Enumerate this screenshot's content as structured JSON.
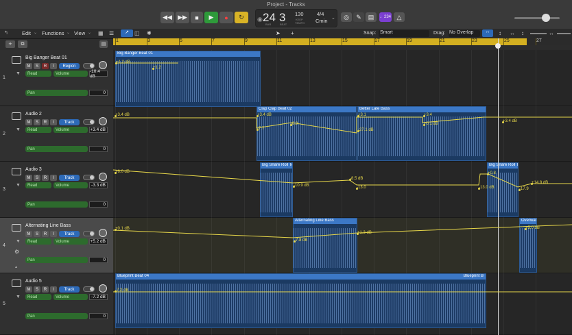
{
  "window": {
    "title": "Project - Tracks"
  },
  "transport": {
    "rewind_icon": "rewind-icon",
    "forward_icon": "forward-icon",
    "stop_icon": "stop-icon",
    "play_icon": "play-icon",
    "record_icon": "record-icon",
    "cycle_icon": "cycle-icon",
    "bar": "24",
    "beat": "3",
    "bar_label": "BAR",
    "beat_label": "BEAT",
    "tempo": "130",
    "tempo_label_1": "KEEP",
    "tempo_label_2": "TEMPO",
    "time_sig": "4/4",
    "key": "Cmin",
    "count_in": "♩234",
    "colors": {
      "play": "#2e9a3a",
      "record": "#d23030",
      "cycle": "#d9b326",
      "purple_btn": "#7b3fd1"
    }
  },
  "menubar": {
    "edit": "Edit",
    "functions": "Functions",
    "view": "View",
    "snap_label": "Snap:",
    "snap_value": "Smart",
    "drag_label": "Drag:",
    "drag_value": "No Overlap"
  },
  "ruler": {
    "bars": [
      "1",
      "3",
      "5",
      "7",
      "9",
      "11",
      "13",
      "15",
      "17",
      "19",
      "21",
      "23",
      "25",
      "27"
    ]
  },
  "tracks": [
    {
      "num": "1",
      "name": "Big Banger Beat 01",
      "automation_mode": "Read",
      "param": "Volume",
      "value": "-10.4 dB",
      "mode_button": "Region",
      "pan_label": "Pan",
      "pan_value": "0",
      "regions": [
        {
          "name": "Big Banger Beat 01"
        }
      ],
      "labels": [
        "+1.2 dB",
        "+1.2"
      ]
    },
    {
      "num": "2",
      "name": "Audio 2",
      "automation_mode": "Read",
      "param": "Volume",
      "value": "+3.4 dB",
      "mode_button": "Track",
      "pan_label": "Pan",
      "pan_value": "0",
      "regions": [
        {
          "name": "Clap Clap Beat 02"
        },
        {
          "name": "Better Late Bass"
        }
      ],
      "labels": [
        "+3.4 dB",
        "+3.4 dB",
        "-8.9",
        "-7.7",
        "+3.1",
        "-27.1 dB",
        "+3.4",
        "+0.1 dB",
        "+3.4 dB"
      ]
    },
    {
      "num": "3",
      "name": "Audio 3",
      "automation_mode": "Read",
      "param": "Volume",
      "value": "-3.3 dB",
      "mode_button": "Track",
      "pan_label": "Pan",
      "pan_value": "0",
      "regions": [
        {
          "name": "Big Snare Roll To"
        },
        {
          "name": "Big Snare Roll To"
        }
      ],
      "labels": [
        "+6.0 dB",
        "-10.9 dB",
        "-8.5 dB",
        "-13.0",
        "+0.8",
        "-13.0 dB",
        "-17.9",
        "+14.8 dB"
      ]
    },
    {
      "num": "4",
      "name": "Alternating Line Bass",
      "automation_mode": "Read",
      "param": "Volume",
      "value": "+5.2 dB",
      "mode_button": "Track",
      "pan_label": "Pan",
      "pan_value": "0",
      "regions": [
        {
          "name": "Alternating Line Bass"
        },
        {
          "name": "Overwat"
        }
      ],
      "labels": [
        "+0.1 dB",
        "-7.8 dB",
        "+1.3 dB",
        "+5.0 dB"
      ]
    },
    {
      "num": "5",
      "name": "Audio 5",
      "automation_mode": "Read",
      "param": "Volume",
      "value": "-7.2 dB",
      "mode_button": "Track",
      "pan_label": "Pan",
      "pan_value": "0",
      "regions": [
        {
          "name": "Blueprint Beat 04"
        }
      ],
      "region_end_label": "Blueprint B",
      "labels": [
        "-7.2 dB"
      ]
    }
  ]
}
